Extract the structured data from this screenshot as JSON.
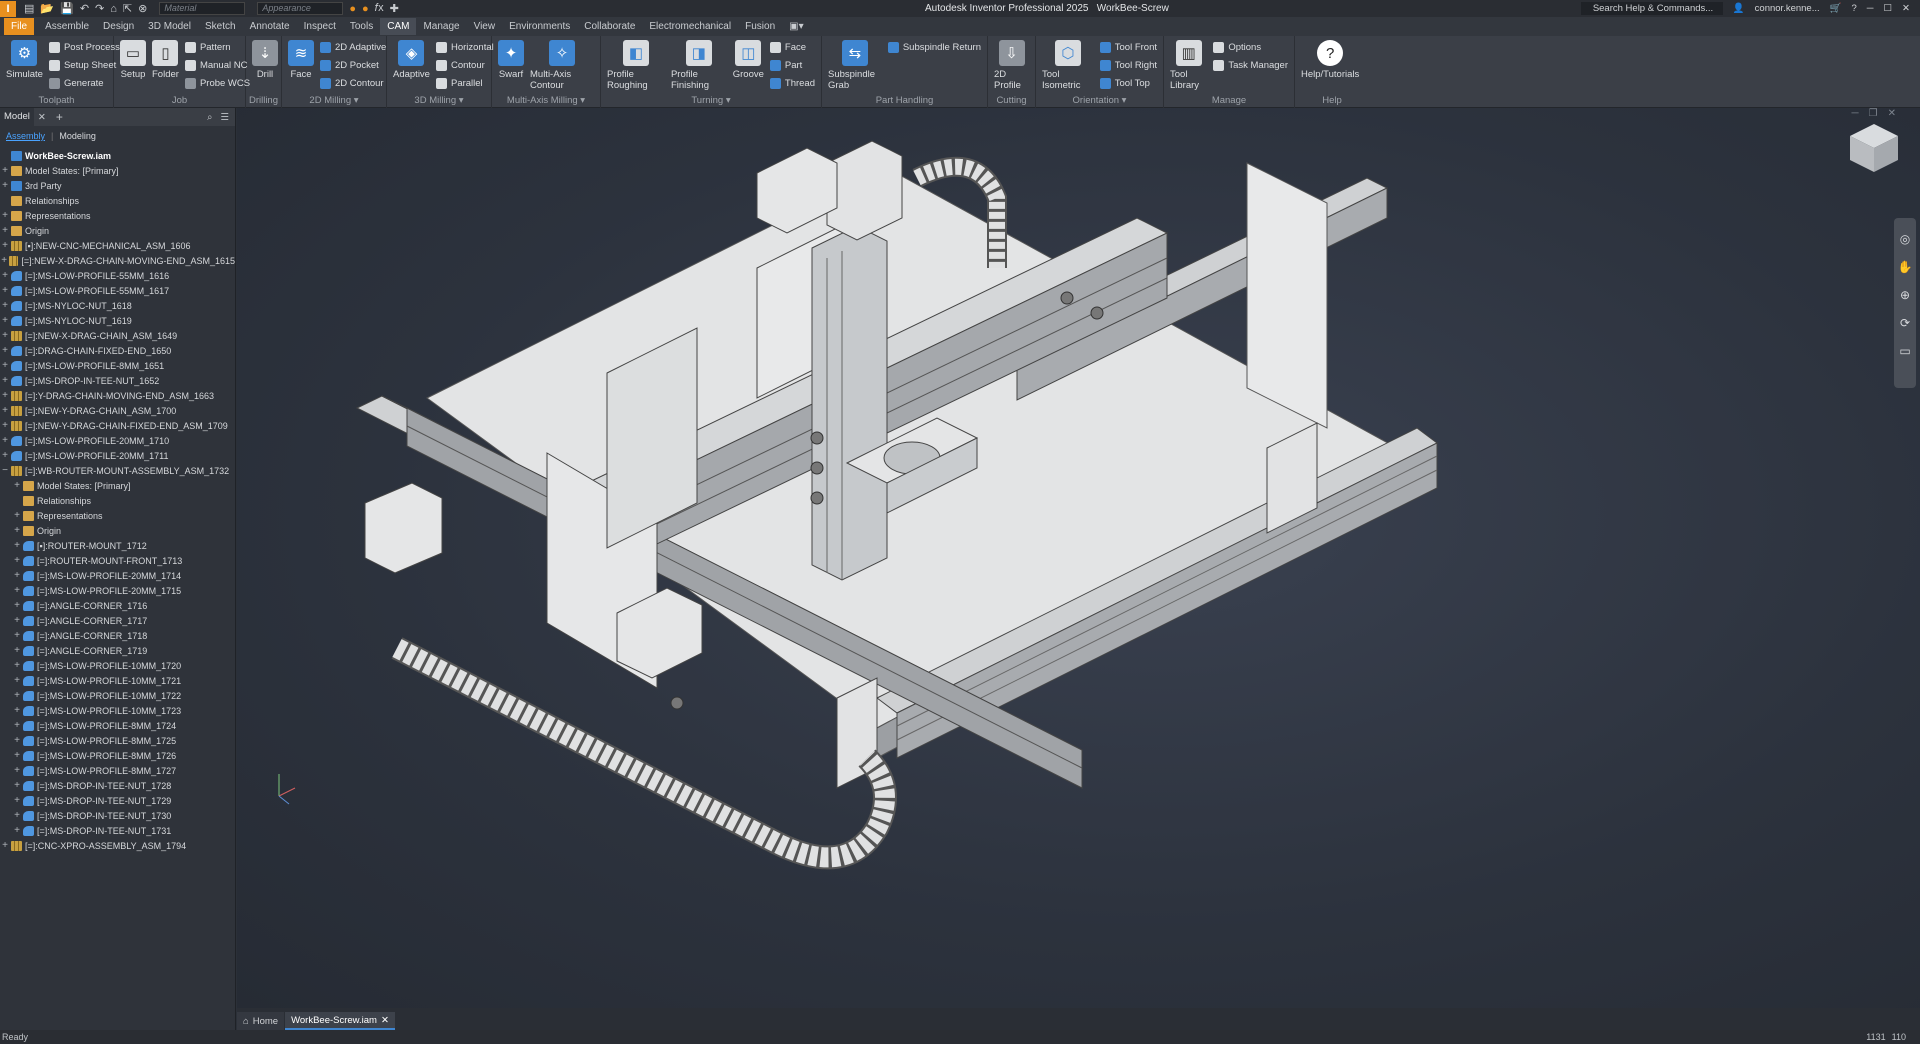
{
  "app": {
    "logo": "I",
    "title": "Autodesk Inventor Professional 2025",
    "document": "WorkBee-Screw",
    "material_placeholder": "Material",
    "appearance_placeholder": "Appearance",
    "search_placeholder": "Search Help & Commands...",
    "user": "connor.kenne..."
  },
  "menu": [
    "File",
    "Assemble",
    "Design",
    "3D Model",
    "Sketch",
    "Annotate",
    "Inspect",
    "Tools",
    "CAM",
    "Manage",
    "View",
    "Environments",
    "Collaborate",
    "Electromechanical",
    "Fusion"
  ],
  "ribbon": {
    "toolpath": {
      "label": "Toolpath",
      "simulate": "Simulate",
      "post_process": "Post Process",
      "setup_sheet": "Setup Sheet",
      "generate": "Generate"
    },
    "job": {
      "label": "Job",
      "setup": "Setup",
      "folder": "Folder",
      "pattern": "Pattern",
      "manual_nc": "Manual NC",
      "probe_wcs": "Probe WCS"
    },
    "drilling": {
      "label": "Drilling",
      "drill": "Drill"
    },
    "milling2d": {
      "label": "2D Milling",
      "face": "Face",
      "adaptive": "2D Adaptive",
      "pocket": "2D Pocket",
      "contour": "2D Contour"
    },
    "milling3d": {
      "label": "3D Milling",
      "adaptive": "Adaptive",
      "horizontal": "Horizontal",
      "contour": "Contour",
      "parallel": "Parallel"
    },
    "multiaxis": {
      "label": "Multi-Axis Milling",
      "swarf": "Swarf",
      "contour": "Multi-Axis Contour"
    },
    "turning": {
      "label": "Turning",
      "roughing": "Profile Roughing",
      "finishing": "Profile Finishing",
      "groove": "Groove",
      "face": "Face",
      "part": "Part",
      "thread": "Thread"
    },
    "part_handling": {
      "label": "Part Handling",
      "grab": "Subspindle Grab",
      "return": "Subspindle Return"
    },
    "cutting": {
      "label": "Cutting",
      "profile": "2D Profile"
    },
    "orientation": {
      "label": "Orientation",
      "isometric": "Tool Isometric",
      "front": "Tool Front",
      "right": "Tool Right",
      "top": "Tool Top"
    },
    "manage": {
      "label": "Manage",
      "library": "Tool Library",
      "options": "Options",
      "task_manager": "Task Manager"
    },
    "help": {
      "label": "Help",
      "tutorials": "Help/Tutorials"
    }
  },
  "browser": {
    "tab": "Model",
    "sub_assembly": "Assembly",
    "sub_modeling": "Modeling",
    "tree": [
      {
        "label": "WorkBee-Screw.iam",
        "icon": "asm",
        "indent": 0,
        "exp": "",
        "root": true
      },
      {
        "label": "Model States: [Primary]",
        "icon": "fold",
        "indent": 0,
        "exp": "+"
      },
      {
        "label": "3rd Party",
        "icon": "asm",
        "indent": 0,
        "exp": "+"
      },
      {
        "label": "Relationships",
        "icon": "fold",
        "indent": 0,
        "exp": ""
      },
      {
        "label": "Representations",
        "icon": "fold",
        "indent": 0,
        "exp": "+"
      },
      {
        "label": "Origin",
        "icon": "fold",
        "indent": 0,
        "exp": "+"
      },
      {
        "label": "[▪]:NEW-CNC-MECHANICAL_ASM_1606",
        "icon": "grid",
        "indent": 0,
        "exp": "+"
      },
      {
        "label": "[=]:NEW-X-DRAG-CHAIN-MOVING-END_ASM_1615",
        "icon": "grid",
        "indent": 0,
        "exp": "+"
      },
      {
        "label": "[=]:MS-LOW-PROFILE-55MM_1616",
        "icon": "part",
        "indent": 0,
        "exp": "+"
      },
      {
        "label": "[=]:MS-LOW-PROFILE-55MM_1617",
        "icon": "part",
        "indent": 0,
        "exp": "+"
      },
      {
        "label": "[=]:MS-NYLOC-NUT_1618",
        "icon": "part",
        "indent": 0,
        "exp": "+"
      },
      {
        "label": "[=]:MS-NYLOC-NUT_1619",
        "icon": "part",
        "indent": 0,
        "exp": "+"
      },
      {
        "label": "[=]:NEW-X-DRAG-CHAIN_ASM_1649",
        "icon": "grid",
        "indent": 0,
        "exp": "+"
      },
      {
        "label": "[=]:DRAG-CHAIN-FIXED-END_1650",
        "icon": "part",
        "indent": 0,
        "exp": "+"
      },
      {
        "label": "[=]:MS-LOW-PROFILE-8MM_1651",
        "icon": "part",
        "indent": 0,
        "exp": "+"
      },
      {
        "label": "[=]:MS-DROP-IN-TEE-NUT_1652",
        "icon": "part",
        "indent": 0,
        "exp": "+"
      },
      {
        "label": "[=]:Y-DRAG-CHAIN-MOVING-END_ASM_1663",
        "icon": "grid",
        "indent": 0,
        "exp": "+"
      },
      {
        "label": "[=]:NEW-Y-DRAG-CHAIN_ASM_1700",
        "icon": "grid",
        "indent": 0,
        "exp": "+"
      },
      {
        "label": "[=]:NEW-Y-DRAG-CHAIN-FIXED-END_ASM_1709",
        "icon": "grid",
        "indent": 0,
        "exp": "+"
      },
      {
        "label": "[=]:MS-LOW-PROFILE-20MM_1710",
        "icon": "part",
        "indent": 0,
        "exp": "+"
      },
      {
        "label": "[=]:MS-LOW-PROFILE-20MM_1711",
        "icon": "part",
        "indent": 0,
        "exp": "+"
      },
      {
        "label": "[=]:WB-ROUTER-MOUNT-ASSEMBLY_ASM_1732",
        "icon": "grid",
        "indent": 0,
        "exp": "−"
      },
      {
        "label": "Model States: [Primary]",
        "icon": "fold",
        "indent": 1,
        "exp": "+"
      },
      {
        "label": "Relationships",
        "icon": "fold",
        "indent": 1,
        "exp": ""
      },
      {
        "label": "Representations",
        "icon": "fold",
        "indent": 1,
        "exp": "+"
      },
      {
        "label": "Origin",
        "icon": "fold",
        "indent": 1,
        "exp": "+"
      },
      {
        "label": "[▪]:ROUTER-MOUNT_1712",
        "icon": "part",
        "indent": 1,
        "exp": "+"
      },
      {
        "label": "[=]:ROUTER-MOUNT-FRONT_1713",
        "icon": "part",
        "indent": 1,
        "exp": "+"
      },
      {
        "label": "[=]:MS-LOW-PROFILE-20MM_1714",
        "icon": "part",
        "indent": 1,
        "exp": "+"
      },
      {
        "label": "[=]:MS-LOW-PROFILE-20MM_1715",
        "icon": "part",
        "indent": 1,
        "exp": "+"
      },
      {
        "label": "[=]:ANGLE-CORNER_1716",
        "icon": "part",
        "indent": 1,
        "exp": "+"
      },
      {
        "label": "[=]:ANGLE-CORNER_1717",
        "icon": "part",
        "indent": 1,
        "exp": "+"
      },
      {
        "label": "[=]:ANGLE-CORNER_1718",
        "icon": "part",
        "indent": 1,
        "exp": "+"
      },
      {
        "label": "[=]:ANGLE-CORNER_1719",
        "icon": "part",
        "indent": 1,
        "exp": "+"
      },
      {
        "label": "[=]:MS-LOW-PROFILE-10MM_1720",
        "icon": "part",
        "indent": 1,
        "exp": "+"
      },
      {
        "label": "[=]:MS-LOW-PROFILE-10MM_1721",
        "icon": "part",
        "indent": 1,
        "exp": "+"
      },
      {
        "label": "[=]:MS-LOW-PROFILE-10MM_1722",
        "icon": "part",
        "indent": 1,
        "exp": "+"
      },
      {
        "label": "[=]:MS-LOW-PROFILE-10MM_1723",
        "icon": "part",
        "indent": 1,
        "exp": "+"
      },
      {
        "label": "[=]:MS-LOW-PROFILE-8MM_1724",
        "icon": "part",
        "indent": 1,
        "exp": "+"
      },
      {
        "label": "[=]:MS-LOW-PROFILE-8MM_1725",
        "icon": "part",
        "indent": 1,
        "exp": "+"
      },
      {
        "label": "[=]:MS-LOW-PROFILE-8MM_1726",
        "icon": "part",
        "indent": 1,
        "exp": "+"
      },
      {
        "label": "[=]:MS-LOW-PROFILE-8MM_1727",
        "icon": "part",
        "indent": 1,
        "exp": "+"
      },
      {
        "label": "[=]:MS-DROP-IN-TEE-NUT_1728",
        "icon": "part",
        "indent": 1,
        "exp": "+"
      },
      {
        "label": "[=]:MS-DROP-IN-TEE-NUT_1729",
        "icon": "part",
        "indent": 1,
        "exp": "+"
      },
      {
        "label": "[=]:MS-DROP-IN-TEE-NUT_1730",
        "icon": "part",
        "indent": 1,
        "exp": "+"
      },
      {
        "label": "[=]:MS-DROP-IN-TEE-NUT_1731",
        "icon": "part",
        "indent": 1,
        "exp": "+"
      },
      {
        "label": "[=]:CNC-XPRO-ASSEMBLY_ASM_1794",
        "icon": "grid",
        "indent": 0,
        "exp": "+"
      }
    ]
  },
  "doctabs": {
    "home": "Home",
    "file": "WorkBee-Screw.iam"
  },
  "status": {
    "text": "Ready",
    "n1": "1131",
    "n2": "110"
  },
  "colors": {
    "accent": "#e8901f",
    "blue": "#3f86d1"
  }
}
